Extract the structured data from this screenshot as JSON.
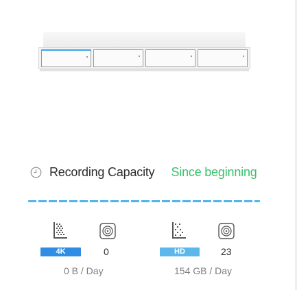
{
  "capacity": {
    "title": "Recording Capacity",
    "range": "Since beginning"
  },
  "colors": {
    "accent_green": "#39c26b",
    "timeline_blue": "#4db4ee",
    "badge_4k": "#2f8de4",
    "badge_hd": "#5cb8ea"
  },
  "stats": [
    {
      "badge": "4K",
      "count": "0",
      "rate": "0 B / Day"
    },
    {
      "badge": "HD",
      "count": "23",
      "rate": "154 GB / Day"
    }
  ]
}
